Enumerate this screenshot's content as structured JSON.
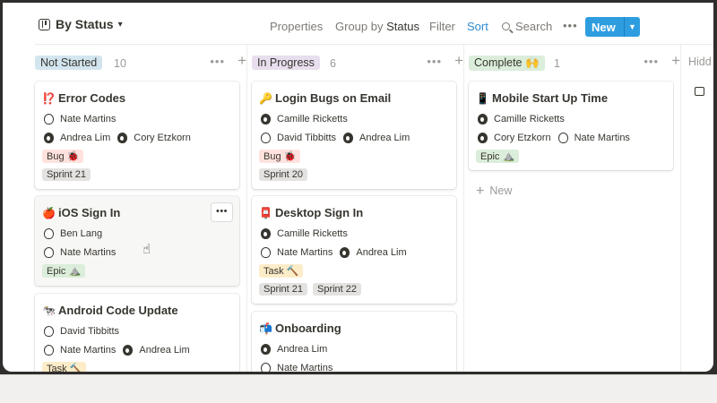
{
  "toolbar": {
    "view_name": "By Status",
    "properties": "Properties",
    "group_by_prefix": "Group by",
    "group_by_value": "Status",
    "filter": "Filter",
    "sort": "Sort",
    "search": "Search",
    "new": "New"
  },
  "columns": [
    {
      "title": "Not Started",
      "count": "10",
      "color": "#d3e5ef",
      "cards": [
        {
          "emoji": "⁉️",
          "title": "Error Codes",
          "rows": [
            [
              "Nate Martins"
            ],
            [
              "Andrea Lim",
              "Cory Etzkorn"
            ]
          ],
          "tags": [
            "Bug 🐞",
            "Sprint 21"
          ]
        },
        {
          "emoji": "🍎",
          "title": "iOS Sign In",
          "rows": [
            [
              "Ben Lang"
            ],
            [
              "Nate Martins"
            ]
          ],
          "tags": [
            "Epic ⛰️"
          ]
        },
        {
          "emoji": "🐄",
          "title": "Android Code Update",
          "rows": [
            [
              "David Tibbitts"
            ],
            [
              "Nate Martins",
              "Andrea Lim"
            ]
          ],
          "tags": [
            "Task 🔨"
          ]
        }
      ]
    },
    {
      "title": "In Progress",
      "count": "6",
      "color": "#e8deee",
      "cards": [
        {
          "emoji": "🔑",
          "title": "Login Bugs on Email",
          "rows": [
            [
              "Camille Ricketts"
            ],
            [
              "David Tibbitts",
              "Andrea Lim"
            ]
          ],
          "tags": [
            "Bug 🐞",
            "Sprint 20"
          ]
        },
        {
          "emoji": "📮",
          "title": "Desktop Sign In",
          "rows": [
            [
              "Camille Ricketts"
            ],
            [
              "Nate Martins",
              "Andrea Lim"
            ]
          ],
          "tags": [
            "Task 🔨",
            "Sprint 21",
            "Sprint 22"
          ]
        },
        {
          "emoji": "📬",
          "title": "Onboarding",
          "rows": [
            [
              "Andrea Lim"
            ],
            [
              "Nate Martins"
            ]
          ],
          "tags": []
        }
      ]
    },
    {
      "title": "Complete 🙌",
      "count": "1",
      "color": "#dbeddb",
      "cards": [
        {
          "emoji": "📱",
          "title": "Mobile Start Up Time",
          "rows": [
            [
              "Camille Ricketts"
            ],
            [
              "Cory Etzkorn",
              "Nate Martins"
            ]
          ],
          "tags": [
            "Epic ⛰️"
          ]
        }
      ],
      "new_label": "New"
    }
  ],
  "hidden_label": "Hidd"
}
